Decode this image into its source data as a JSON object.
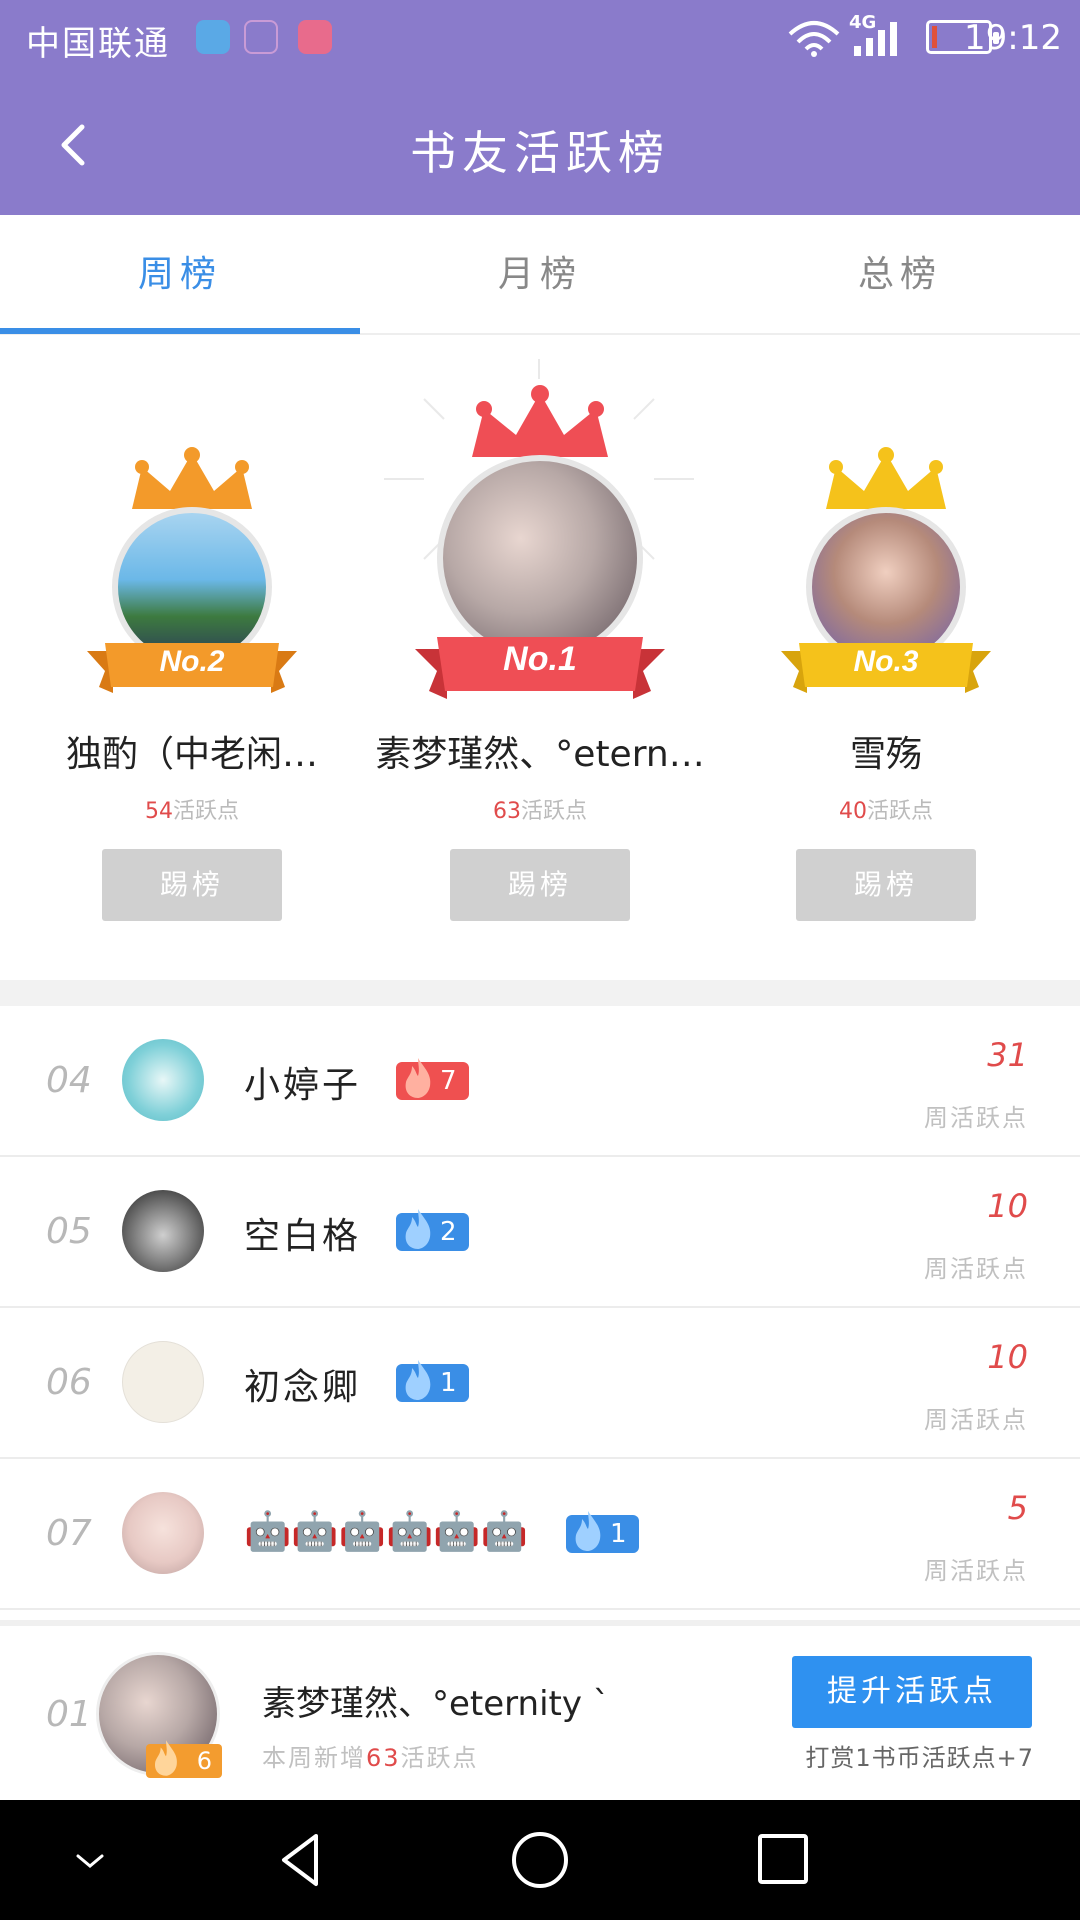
{
  "status_bar": {
    "carrier": "中国联通",
    "network": "4G",
    "time": "19:12"
  },
  "header": {
    "title": "书友活跃榜"
  },
  "tabs": [
    {
      "label": "周榜",
      "active": true
    },
    {
      "label": "月榜",
      "active": false
    },
    {
      "label": "总榜",
      "active": false
    }
  ],
  "podium": [
    {
      "rank_label": "No.2",
      "name": "独酌（中老闲…",
      "points": "54",
      "points_suffix": "活跃点",
      "button": "踢榜",
      "crown_color": "#f39a2a"
    },
    {
      "rank_label": "No.1",
      "name": "素梦瑾然、°etern…",
      "points": "63",
      "points_suffix": "活跃点",
      "button": "踢榜",
      "crown_color": "#ef4e55"
    },
    {
      "rank_label": "No.3",
      "name": "雪殇",
      "points": "40",
      "points_suffix": "活跃点",
      "button": "踢榜",
      "crown_color": "#f5c21b"
    }
  ],
  "list": [
    {
      "rank": "04",
      "name": "小婷子",
      "badge": "7",
      "badge_color": "#ef5050",
      "score": "31",
      "score_label": "周活跃点",
      "avatar_color": "#7fd0d8"
    },
    {
      "rank": "05",
      "name": "空白格",
      "badge": "2",
      "badge_color": "#3a8ee6",
      "score": "10",
      "score_label": "周活跃点",
      "avatar_color": "#555555"
    },
    {
      "rank": "06",
      "name": "初念卿",
      "badge": "1",
      "badge_color": "#3a8ee6",
      "score": "10",
      "score_label": "周活跃点",
      "avatar_color": "#f3efe6"
    },
    {
      "rank": "07",
      "name": "🤖🤖🤖🤖🤖🤖",
      "badge": "1",
      "badge_color": "#3a8ee6",
      "score": "5",
      "score_label": "周活跃点",
      "avatar_color": "#e7c9c4"
    }
  ],
  "me": {
    "rank": "01",
    "name": "素梦瑾然、°eternity ˋ",
    "badge": "6",
    "sub_prefix": "本周新增",
    "sub_points": "63",
    "sub_suffix": "活跃点",
    "cta": "提升活跃点",
    "hint": "打赏1书币活跃点+7"
  }
}
